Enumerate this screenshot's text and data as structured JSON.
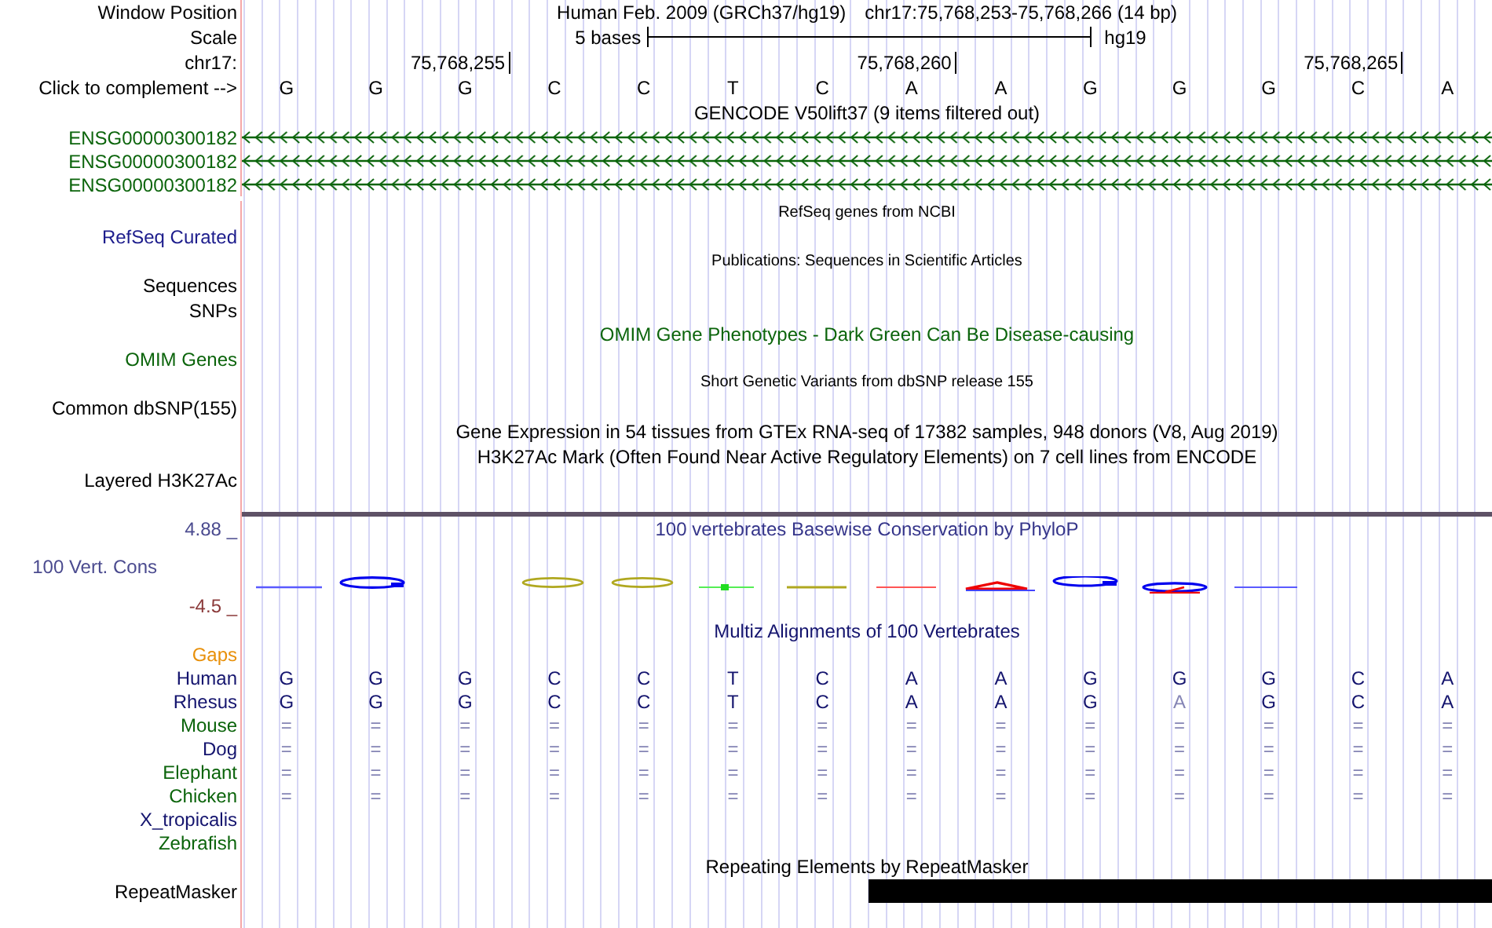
{
  "position": {
    "label": "Window Position",
    "assembly": "Human Feb. 2009 (GRCh37/hg19)",
    "range": "chr17:75,768,253-75,768,266 (14 bp)"
  },
  "scale": {
    "label": "Scale",
    "text": "5 bases",
    "assembly": "hg19"
  },
  "coordinates": {
    "label": "chr17:",
    "ticks": [
      "75,768,255",
      "75,768,260",
      "75,768,265"
    ]
  },
  "sequence": {
    "label": "Click to complement -->",
    "bases": [
      "G",
      "G",
      "G",
      "C",
      "C",
      "T",
      "C",
      "A",
      "A",
      "G",
      "G",
      "G",
      "C",
      "A"
    ]
  },
  "gencode": {
    "title": "GENCODE V50lift37 (9 items filtered out)",
    "genes": [
      {
        "name": "ENSG00000300182"
      },
      {
        "name": "ENSG00000300182"
      },
      {
        "name": "ENSG00000300182"
      }
    ]
  },
  "tracks": [
    {
      "kind": "small_title",
      "text": "RefSeq genes from NCBI",
      "color": "#000000"
    },
    {
      "kind": "label",
      "text": "RefSeq Curated",
      "color": "#1c1c8c"
    },
    {
      "kind": "small_title",
      "text": "Publications: Sequences in Scientific Articles",
      "color": "#000000"
    },
    {
      "kind": "label",
      "text": "Sequences",
      "color": "#000000"
    },
    {
      "kind": "label",
      "text": "SNPs",
      "color": "#000000"
    },
    {
      "kind": "title",
      "text": "OMIM Gene Phenotypes - Dark Green Can Be Disease-causing",
      "color": "#0b640b"
    },
    {
      "kind": "label",
      "text": "OMIM Genes",
      "color": "#0b640b"
    },
    {
      "kind": "small_title",
      "text": "Short Genetic Variants from dbSNP release 155",
      "color": "#000000"
    },
    {
      "kind": "label",
      "text": "Common dbSNP(155)",
      "color": "#000000"
    },
    {
      "kind": "title",
      "text": "Gene Expression in 54 tissues from GTEx RNA-seq of 17382 samples, 948 donors (V8, Aug 2019)",
      "color": "#000000"
    },
    {
      "kind": "title",
      "text": "H3K27Ac Mark (Often Found Near Active Regulatory Elements) on 7 cell lines from ENCODE",
      "color": "#000000"
    },
    {
      "kind": "label",
      "text": "Layered H3K27Ac",
      "color": "#000000"
    }
  ],
  "phylop": {
    "title": "100 vertebrates Basewise Conservation by PhyloP",
    "label": "100 Vert. Cons",
    "max": "4.88 _",
    "min": "-4.5 _"
  },
  "multiz": {
    "title": "Multiz Alignments of 100 Vertebrates",
    "gaps_label": "Gaps",
    "species": [
      {
        "name": "Human",
        "color": "#14146e",
        "bases": [
          {
            "text": "G",
            "faint": false
          },
          {
            "text": "G",
            "faint": false
          },
          {
            "text": "G",
            "faint": false
          },
          {
            "text": "C",
            "faint": false
          },
          {
            "text": "C",
            "faint": false
          },
          {
            "text": "T",
            "faint": false
          },
          {
            "text": "C",
            "faint": false
          },
          {
            "text": "A",
            "faint": false
          },
          {
            "text": "A",
            "faint": false
          },
          {
            "text": "G",
            "faint": false
          },
          {
            "text": "G",
            "faint": false
          },
          {
            "text": "G",
            "faint": false
          },
          {
            "text": "C",
            "faint": false
          },
          {
            "text": "A",
            "faint": false
          }
        ]
      },
      {
        "name": "Rhesus",
        "color": "#14146e",
        "bases": [
          {
            "text": "G",
            "faint": false
          },
          {
            "text": "G",
            "faint": false
          },
          {
            "text": "G",
            "faint": false
          },
          {
            "text": "C",
            "faint": false
          },
          {
            "text": "C",
            "faint": false
          },
          {
            "text": "T",
            "faint": false
          },
          {
            "text": "C",
            "faint": false
          },
          {
            "text": "A",
            "faint": false
          },
          {
            "text": "A",
            "faint": false
          },
          {
            "text": "G",
            "faint": false
          },
          {
            "text": "A",
            "faint": true
          },
          {
            "text": "G",
            "faint": false
          },
          {
            "text": "C",
            "faint": false
          },
          {
            "text": "A",
            "faint": false
          }
        ]
      },
      {
        "name": "Mouse",
        "color": "#0b640b",
        "bases": [
          {
            "text": "=",
            "faint": true
          },
          {
            "text": "=",
            "faint": true
          },
          {
            "text": "=",
            "faint": true
          },
          {
            "text": "=",
            "faint": true
          },
          {
            "text": "=",
            "faint": true
          },
          {
            "text": "=",
            "faint": true
          },
          {
            "text": "=",
            "faint": true
          },
          {
            "text": "=",
            "faint": true
          },
          {
            "text": "=",
            "faint": true
          },
          {
            "text": "=",
            "faint": true
          },
          {
            "text": "=",
            "faint": true
          },
          {
            "text": "=",
            "faint": true
          },
          {
            "text": "=",
            "faint": true
          },
          {
            "text": "=",
            "faint": true
          }
        ]
      },
      {
        "name": "Dog",
        "color": "#14146e",
        "bases": [
          {
            "text": "=",
            "faint": true
          },
          {
            "text": "=",
            "faint": true
          },
          {
            "text": "=",
            "faint": true
          },
          {
            "text": "=",
            "faint": true
          },
          {
            "text": "=",
            "faint": true
          },
          {
            "text": "=",
            "faint": true
          },
          {
            "text": "=",
            "faint": true
          },
          {
            "text": "=",
            "faint": true
          },
          {
            "text": "=",
            "faint": true
          },
          {
            "text": "=",
            "faint": true
          },
          {
            "text": "=",
            "faint": true
          },
          {
            "text": "=",
            "faint": true
          },
          {
            "text": "=",
            "faint": true
          },
          {
            "text": "=",
            "faint": true
          }
        ]
      },
      {
        "name": "Elephant",
        "color": "#0b640b",
        "bases": [
          {
            "text": "=",
            "faint": true
          },
          {
            "text": "=",
            "faint": true
          },
          {
            "text": "=",
            "faint": true
          },
          {
            "text": "=",
            "faint": true
          },
          {
            "text": "=",
            "faint": true
          },
          {
            "text": "=",
            "faint": true
          },
          {
            "text": "=",
            "faint": true
          },
          {
            "text": "=",
            "faint": true
          },
          {
            "text": "=",
            "faint": true
          },
          {
            "text": "=",
            "faint": true
          },
          {
            "text": "=",
            "faint": true
          },
          {
            "text": "=",
            "faint": true
          },
          {
            "text": "=",
            "faint": true
          },
          {
            "text": "=",
            "faint": true
          }
        ]
      },
      {
        "name": "Chicken",
        "color": "#0b640b",
        "bases": [
          {
            "text": "=",
            "faint": true
          },
          {
            "text": "=",
            "faint": true
          },
          {
            "text": "=",
            "faint": true
          },
          {
            "text": "=",
            "faint": true
          },
          {
            "text": "=",
            "faint": true
          },
          {
            "text": "=",
            "faint": true
          },
          {
            "text": "=",
            "faint": true
          },
          {
            "text": "=",
            "faint": true
          },
          {
            "text": "=",
            "faint": true
          },
          {
            "text": "=",
            "faint": true
          },
          {
            "text": "=",
            "faint": true
          },
          {
            "text": "=",
            "faint": true
          },
          {
            "text": "=",
            "faint": true
          },
          {
            "text": "=",
            "faint": true
          }
        ]
      },
      {
        "name": "X_tropicalis",
        "color": "#14146e"
      },
      {
        "name": "Zebrafish",
        "color": "#0b640b"
      }
    ]
  },
  "repeatmasker": {
    "title": "Repeating Elements by RepeatMasker",
    "label": "RepeatMasker"
  }
}
